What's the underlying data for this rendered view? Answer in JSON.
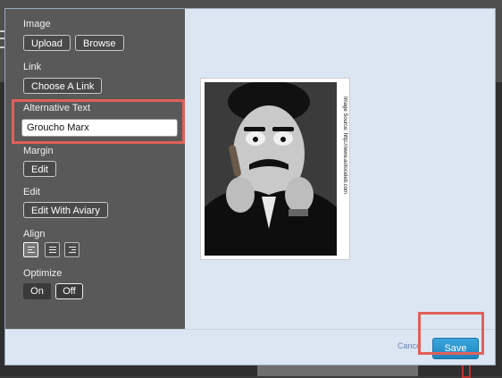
{
  "panel": {
    "image_label": "Image",
    "upload_label": "Upload",
    "browse_label": "Browse",
    "link_label": "Link",
    "choose_link_label": "Choose A Link",
    "alt_text_label": "Alternative Text",
    "alt_text_value": "Groucho Marx",
    "margin_label": "Margin",
    "margin_edit_label": "Edit",
    "edit_label": "Edit",
    "edit_aviary_label": "Edit With Aviary",
    "align_label": "Align",
    "align_options": [
      "left",
      "center",
      "right"
    ],
    "align_selected": "left",
    "optimize_label": "Optimize",
    "optimize_on": "On",
    "optimize_off": "Off",
    "optimize_selected": "Off"
  },
  "preview": {
    "image_credit": "Image Source: http://www.aotoceleb.com"
  },
  "footer": {
    "cancel_label": "Cance",
    "save_label": "Save"
  },
  "colors": {
    "panel_bg": "#595959",
    "preview_bg": "#dce6f2",
    "save_blue": "#2a96d0",
    "highlight_red": "#e0605a"
  }
}
